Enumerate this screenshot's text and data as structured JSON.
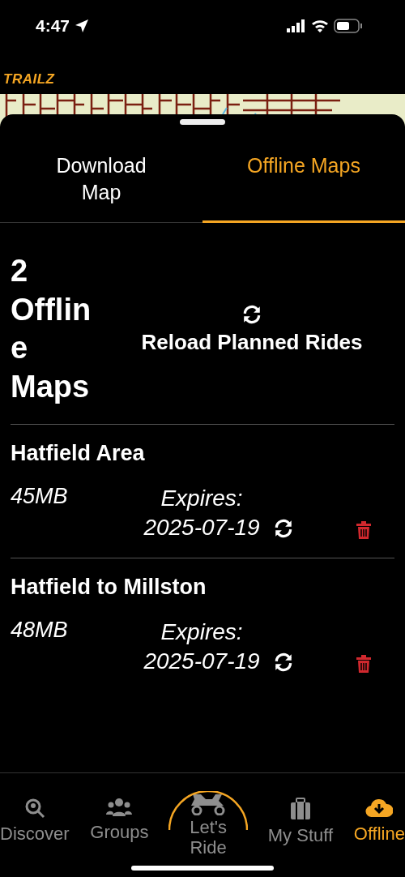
{
  "status_bar": {
    "time": "4:47"
  },
  "app": {
    "logo": "TRAILZ"
  },
  "tabs": [
    {
      "label": "Download Map",
      "selected": false
    },
    {
      "label": "Offline Maps",
      "selected": true
    }
  ],
  "header": {
    "title": "2 Offline Maps",
    "reload_label": "Reload Planned Rides"
  },
  "offline_maps": [
    {
      "name": "Hatfield Area",
      "size": "45MB",
      "expires": "Expires: 2025-07-19"
    },
    {
      "name": "Hatfield to Millston",
      "size": "48MB",
      "expires": "Expires: 2025-07-19"
    }
  ],
  "nav": [
    {
      "kind": "discover",
      "label": "Discover",
      "selected": false
    },
    {
      "kind": "groups",
      "label": "Groups",
      "selected": false
    },
    {
      "kind": "ride",
      "label": "Let's Ride",
      "selected": false
    },
    {
      "kind": "stuff",
      "label": "My Stuff",
      "selected": false
    },
    {
      "kind": "offline",
      "label": "Offline",
      "selected": true
    }
  ]
}
